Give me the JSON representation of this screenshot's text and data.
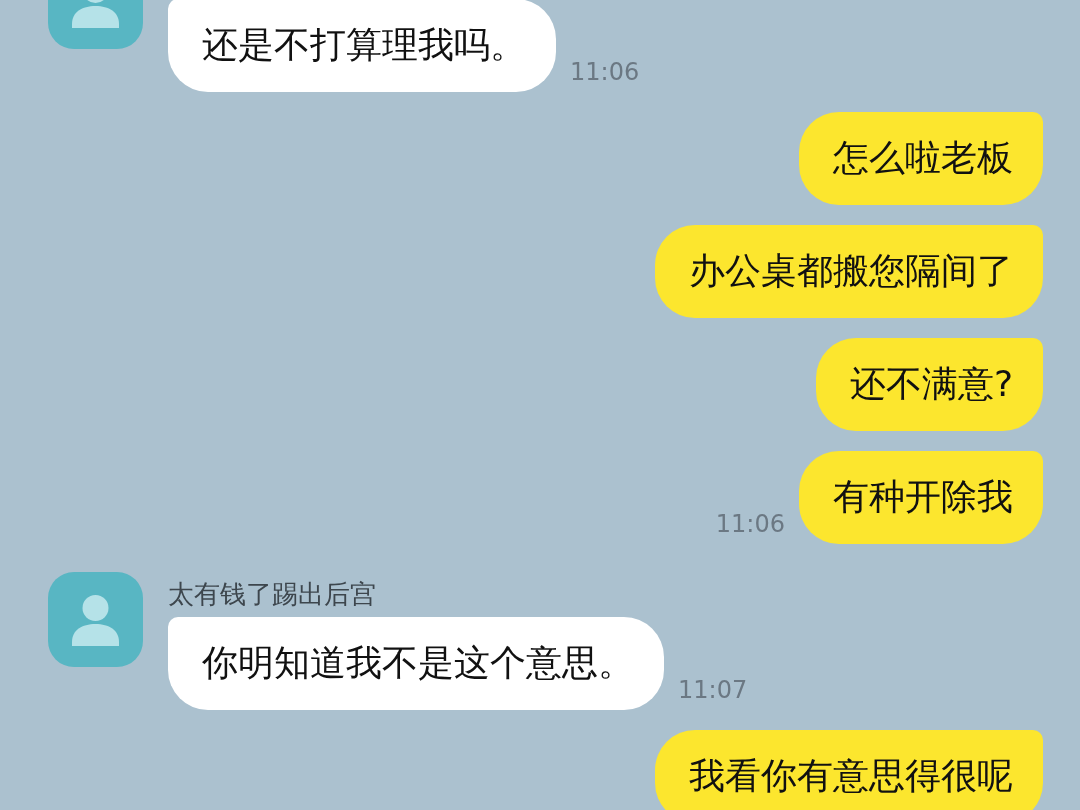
{
  "messages": [
    {
      "kind": "incoming",
      "bubbles": [
        "还是不打算理我吗。"
      ],
      "time": "11:06"
    },
    {
      "kind": "outgoing",
      "bubbles": [
        "怎么啦老板",
        "办公桌都搬您隔间了",
        "还不满意?",
        "有种开除我"
      ],
      "time": "11:06"
    },
    {
      "kind": "incoming",
      "sender": "太有钱了踢出后宫",
      "bubbles": [
        "你明知道我不是这个意思。"
      ],
      "time": "11:07"
    },
    {
      "kind": "outgoing",
      "bubbles": [
        "我看你有意思得很呢"
      ]
    }
  ]
}
